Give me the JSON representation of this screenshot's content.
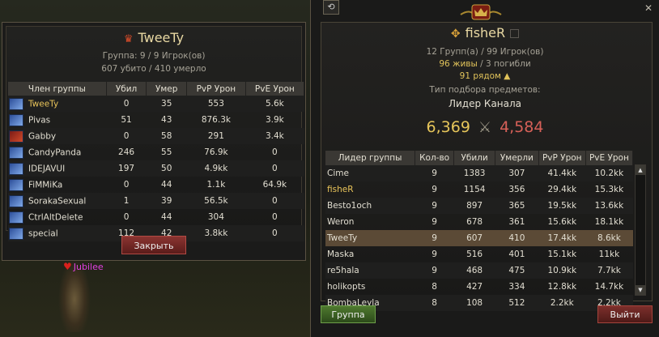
{
  "scene": {
    "char_label": "Jubilee"
  },
  "left": {
    "title": "TweeTy",
    "groups_line": "Группа: 9 / 9 Игрок(ов)",
    "kills_line": "607 убито / 410 умерло",
    "columns": [
      "Член группы",
      "Убил",
      "Умер",
      "PvP Урон",
      "PvE Урон"
    ],
    "rows": [
      {
        "name": "TweeTy",
        "kills": "0",
        "deaths": "35",
        "pvp": "553",
        "pve": "5.6k",
        "cls": "blue",
        "self": true
      },
      {
        "name": "Pivas",
        "kills": "51",
        "deaths": "43",
        "pvp": "876.3k",
        "pve": "3.9k",
        "cls": "blue"
      },
      {
        "name": "Gabby",
        "kills": "0",
        "deaths": "58",
        "pvp": "291",
        "pve": "3.4k",
        "cls": "red"
      },
      {
        "name": "CandyPanda",
        "kills": "246",
        "deaths": "55",
        "pvp": "76.9k",
        "pve": "0",
        "cls": "blue"
      },
      {
        "name": "IDEJAVUI",
        "kills": "197",
        "deaths": "50",
        "pvp": "4.9kk",
        "pve": "0",
        "cls": "blue"
      },
      {
        "name": "FiMMiKa",
        "kills": "0",
        "deaths": "44",
        "pvp": "1.1k",
        "pve": "64.9k",
        "cls": "blue"
      },
      {
        "name": "SorakaSexual",
        "kills": "1",
        "deaths": "39",
        "pvp": "56.5k",
        "pve": "0",
        "cls": "blue"
      },
      {
        "name": "CtrlAltDelete",
        "kills": "0",
        "deaths": "44",
        "pvp": "304",
        "pve": "0",
        "cls": "blue"
      },
      {
        "name": "special",
        "kills": "112",
        "deaths": "42",
        "pvp": "3.8kk",
        "pve": "0",
        "cls": "blue"
      }
    ],
    "close_label": "Закрыть"
  },
  "right": {
    "title": "fisheR",
    "groups_line": "12 Групп(а) / 99 Игрок(ов)",
    "alive": "96 живы",
    "dead": " / 3 погибли",
    "nearby": "91 рядом",
    "loot_label": "Тип подбора предметов:",
    "loot_value": "Лидер Канала",
    "score_a": "6,369",
    "score_b": "4,584",
    "columns": [
      "Лидер группы",
      "Кол-во",
      "Убили",
      "Умерли",
      "PvP Урон",
      "PvE Урон"
    ],
    "rows": [
      {
        "name": "Cime",
        "count": "9",
        "kills": "1383",
        "deaths": "307",
        "pvp": "41.4kk",
        "pve": "10.2kk"
      },
      {
        "name": "fisheR",
        "count": "9",
        "kills": "1154",
        "deaths": "356",
        "pvp": "29.4kk",
        "pve": "15.3kk",
        "gold": true
      },
      {
        "name": "Besto1och",
        "count": "9",
        "kills": "897",
        "deaths": "365",
        "pvp": "19.5kk",
        "pve": "13.6kk"
      },
      {
        "name": "Weron",
        "count": "9",
        "kills": "678",
        "deaths": "361",
        "pvp": "15.6kk",
        "pve": "18.1kk"
      },
      {
        "name": "TweeTy",
        "count": "9",
        "kills": "607",
        "deaths": "410",
        "pvp": "17.4kk",
        "pve": "8.6kk",
        "selected": true
      },
      {
        "name": "Maska",
        "count": "9",
        "kills": "516",
        "deaths": "401",
        "pvp": "15.1kk",
        "pve": "11kk"
      },
      {
        "name": "re5hala",
        "count": "9",
        "kills": "468",
        "deaths": "475",
        "pvp": "10.9kk",
        "pve": "7.7kk"
      },
      {
        "name": "holikopts",
        "count": "8",
        "kills": "427",
        "deaths": "334",
        "pvp": "12.8kk",
        "pve": "14.7kk"
      },
      {
        "name": "BombaLeyla",
        "count": "8",
        "kills": "108",
        "deaths": "512",
        "pvp": "2.2kk",
        "pve": "2.2kk"
      }
    ],
    "group_label": "Группа",
    "exit_label": "Выйти"
  },
  "colors": {
    "gold": "#e9c45a",
    "score_a": "#e6c55a",
    "score_b": "#d66058",
    "selected_row": "#5b4a36"
  }
}
